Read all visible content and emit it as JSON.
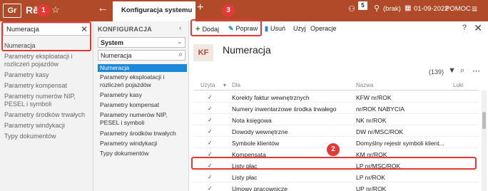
{
  "topbar": {
    "logo": "Gr",
    "app_title": "Rē",
    "marker1": "1",
    "marker3": "3",
    "active_tab": "Konfiguracja systemu",
    "notifications": "5",
    "user_label": "(brak)",
    "date": "01-09-2022",
    "pomoc": "POMOC"
  },
  "left": {
    "search_value": "Numeracja",
    "items": [
      "Numeracja",
      "Parametry eksploatacji i rozliczeń pojazdów",
      "Parametry kasy",
      "Parametry kompensat",
      "Parametry numerów NIP, PESEL i symboli",
      "Parametry środków trwałych",
      "Parametry windykacji",
      "Typy dokumentów"
    ]
  },
  "middle": {
    "header": "KONFIGURACJA",
    "select_value": "System",
    "search_value": "Numeracja",
    "items": [
      "Numeracja",
      "Parametry eksploatacji i rozliczeń pojazdów",
      "Parametry kasy",
      "Parametry kompensat",
      "Parametry numerów NIP, PESEL i symboli",
      "Parametry środków trwałych",
      "Parametry windykacji",
      "Typy dokumentów"
    ]
  },
  "toolbar": {
    "dodaj": "Dodaj",
    "popraw": "Popraw",
    "usun": "Usuń",
    "uzyj": "Użyj",
    "operacje": "Operacje"
  },
  "main": {
    "icon_text": "KF",
    "title": "Numeracja",
    "count": "(139)",
    "marker2": "2",
    "columns": [
      "Użyta",
      "Dla",
      "Nazwa",
      "Luki"
    ],
    "rows": [
      {
        "check": "✓",
        "dla": "Korekty faktur wewnętrznych",
        "nazwa": "KFW nr/ROK"
      },
      {
        "check": "✓",
        "dla": "Numery inwentarzowe środka trwałego",
        "nazwa": "nr/ROK NABYCIA"
      },
      {
        "check": "✓",
        "dla": "Nota księgowa",
        "nazwa": "NK nr/ROK"
      },
      {
        "check": "✓",
        "dla": "Dowody wewnętrzne",
        "nazwa": "DW nr/MSC/ROK"
      },
      {
        "check": "✓",
        "dla": "Symbole klientów",
        "nazwa": "Domyślny rejestr symboli klient..."
      },
      {
        "check": "✓",
        "dla": "Kompensata",
        "nazwa": "KM nr/ROK"
      },
      {
        "check": "✓",
        "dla": "Listy płac",
        "nazwa": "LP nr/MSC/ROK"
      },
      {
        "check": "✓",
        "dla": "Listy płac",
        "nazwa": "LP nr/ROK"
      },
      {
        "check": "✓",
        "dla": "Umowy pracownicze",
        "nazwa": "UP nr/ROK"
      }
    ]
  },
  "colors": {
    "brand": "#b04a28",
    "selected": "#1e88d8",
    "marker": "#e53935",
    "dodaj_icon": "#2e7d32",
    "popraw_icon": "#1e88d8",
    "usun_icon": "#1e88d8"
  },
  "icons": [
    "star-icon",
    "back-arrow-icon",
    "plus-icon",
    "user-icon",
    "calendar-icon",
    "menu-icon",
    "close-icon",
    "search-icon",
    "filter-icon",
    "more-icon",
    "trash-icon",
    "brush-icon"
  ]
}
